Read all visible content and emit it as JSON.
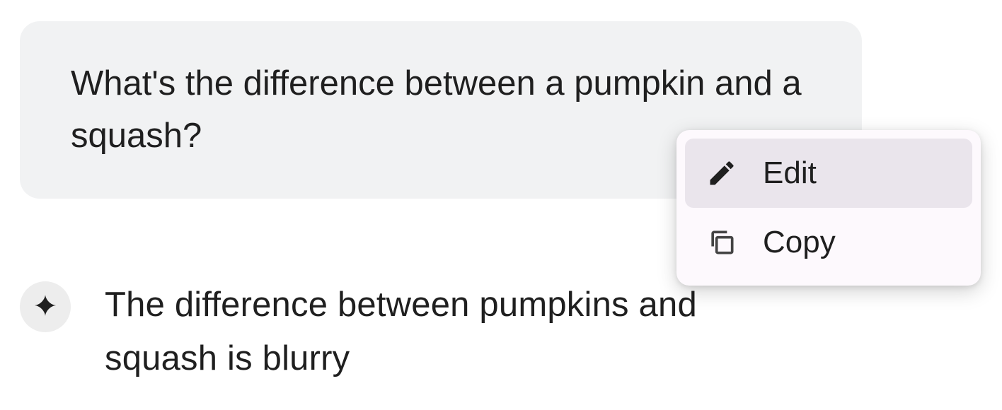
{
  "user_message": {
    "text": "What's the difference between a pumpkin and a squash?"
  },
  "assistant_response": {
    "text": "The difference between pumpkins and squash is blurry"
  },
  "context_menu": {
    "items": [
      {
        "label": "Edit",
        "icon": "pencil-icon",
        "highlighted": true
      },
      {
        "label": "Copy",
        "icon": "copy-icon",
        "highlighted": false
      }
    ]
  }
}
